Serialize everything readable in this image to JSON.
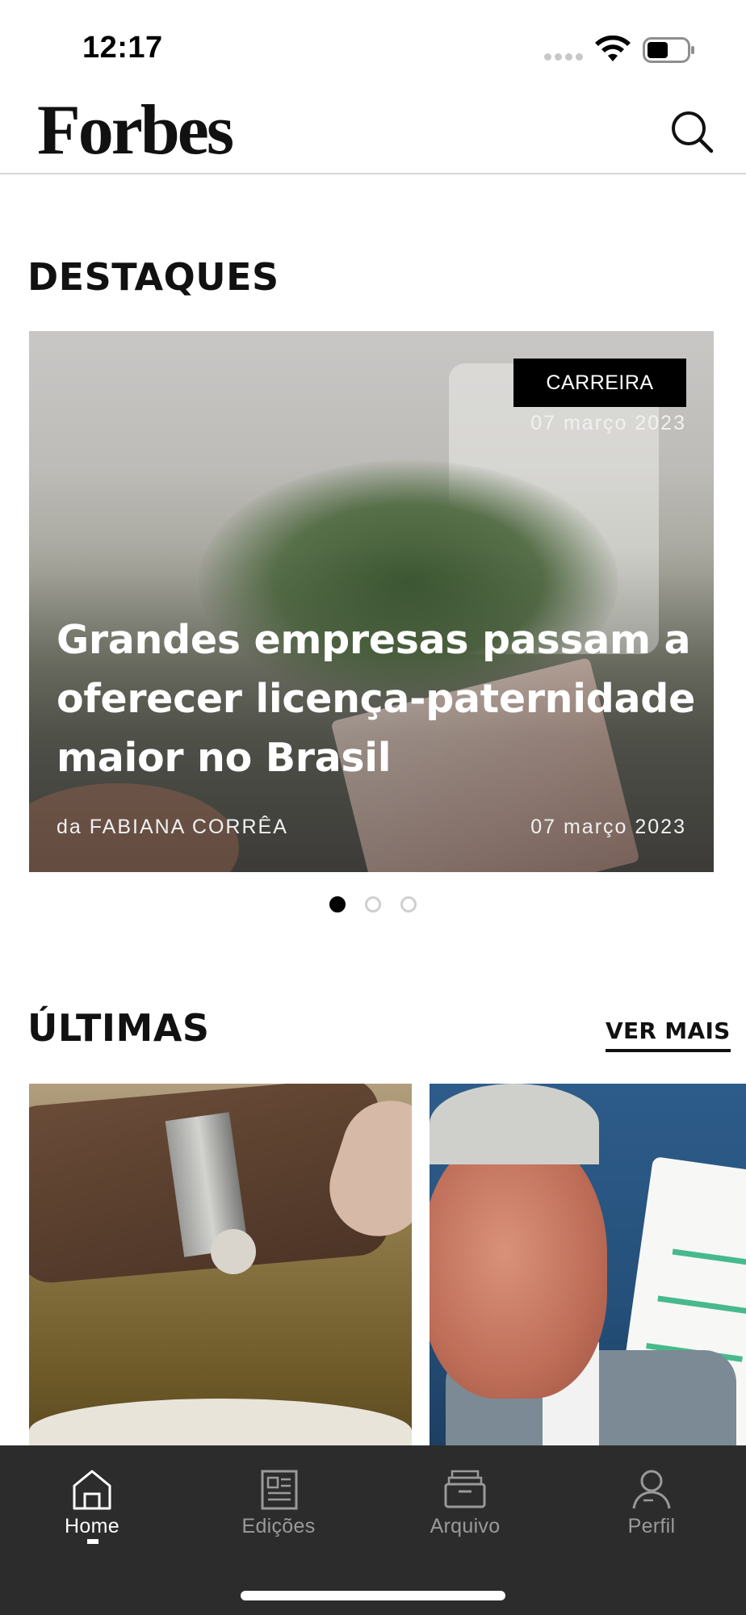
{
  "status_bar": {
    "time": "12:17"
  },
  "header": {
    "logo": "Forbes",
    "search_icon": "search-icon"
  },
  "highlights": {
    "title": "DESTAQUES",
    "card": {
      "category": "CARREIRA",
      "date_top": "07 março 2023",
      "headline": "Grandes empresas passam a oferecer licença-paternidade maior no Brasil",
      "author": "da FABIANA CORRÊA",
      "date_bottom": "07 março 2023"
    },
    "pagination": {
      "total": 3,
      "active": 1
    }
  },
  "latest": {
    "title": "ÚLTIMAS",
    "see_more": "VER MAIS"
  },
  "tabbar": {
    "items": [
      {
        "label": "Home",
        "icon": "home-icon",
        "active": true
      },
      {
        "label": "Edições",
        "icon": "newspaper-icon",
        "active": false
      },
      {
        "label": "Arquivo",
        "icon": "archive-icon",
        "active": false
      },
      {
        "label": "Perfil",
        "icon": "profile-icon",
        "active": false
      }
    ]
  },
  "colors": {
    "tabbar_bg": "#2c2c2c",
    "badge_bg": "#000000",
    "text": "#111111"
  }
}
